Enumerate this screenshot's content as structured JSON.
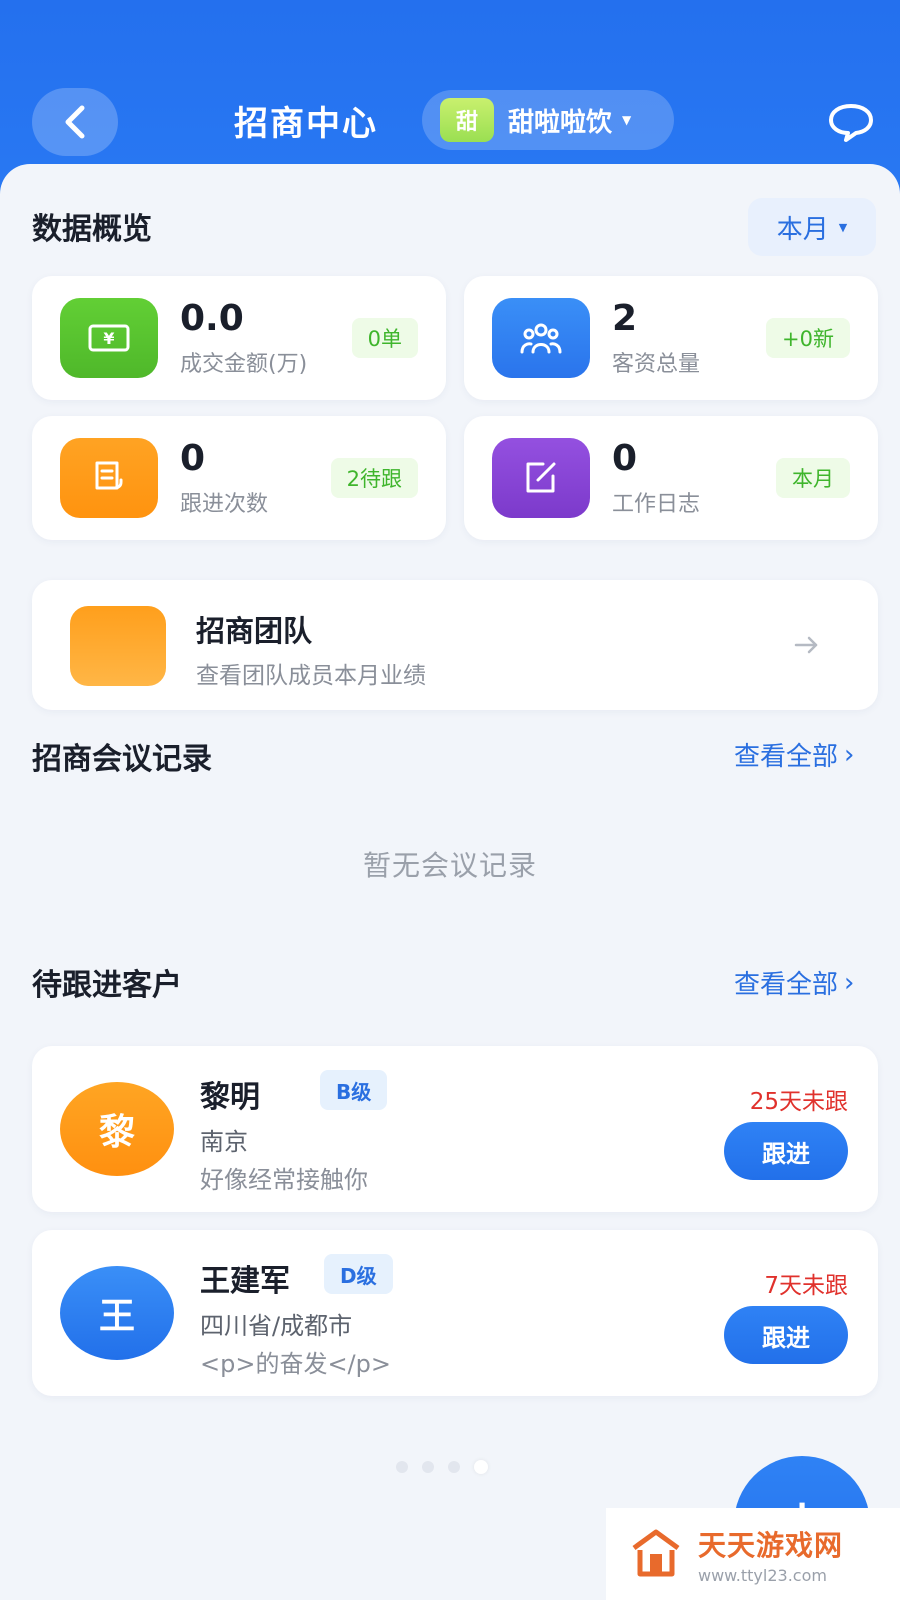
{
  "header": {
    "title": "招商中心",
    "brand_badge": "甜",
    "brand_name": "甜啦啦饮"
  },
  "overview": {
    "title": "数据概览",
    "period": "本月",
    "stats": [
      {
        "value": "0.0",
        "label": "成交金额(万)",
        "tag": "0单",
        "icon": "money-icon",
        "color": "#59c52f"
      },
      {
        "value": "2",
        "label": "客资总量",
        "tag": "+0新",
        "icon": "users-icon",
        "color": "#2f7ef2"
      },
      {
        "value": "0",
        "label": "跟进次数",
        "tag": "2待跟",
        "icon": "document-icon",
        "color": "#ff9b1a"
      },
      {
        "value": "0",
        "label": "工作日志",
        "tag": "本月",
        "icon": "edit-icon",
        "color": "#8a45d6"
      }
    ]
  },
  "team": {
    "title": "招商团队",
    "subtitle": "查看团队成员本月业绩"
  },
  "meetings": {
    "title": "招商会议记录",
    "view_all": "查看全部",
    "empty": "暂无会议记录"
  },
  "customers": {
    "title": "待跟进客户",
    "view_all": "查看全部",
    "follow_label": "跟进",
    "items": [
      {
        "avatar": "黎",
        "name": "黎明",
        "level": "B级",
        "city": "南京",
        "note": "好像经常接触你",
        "days": "25天未跟"
      },
      {
        "avatar": "王",
        "name": "王建军",
        "level": "D级",
        "city": "四川省/成都市",
        "note": "<p>的奋发</p>",
        "days": "7天未跟"
      }
    ]
  },
  "fab": {
    "label": "+"
  },
  "watermark": {
    "title": "天天游戏网",
    "url": "www.ttyl23.com"
  },
  "colors": {
    "primary": "#2a7bf5",
    "danger": "#e0312c",
    "success": "#3fb52c"
  }
}
